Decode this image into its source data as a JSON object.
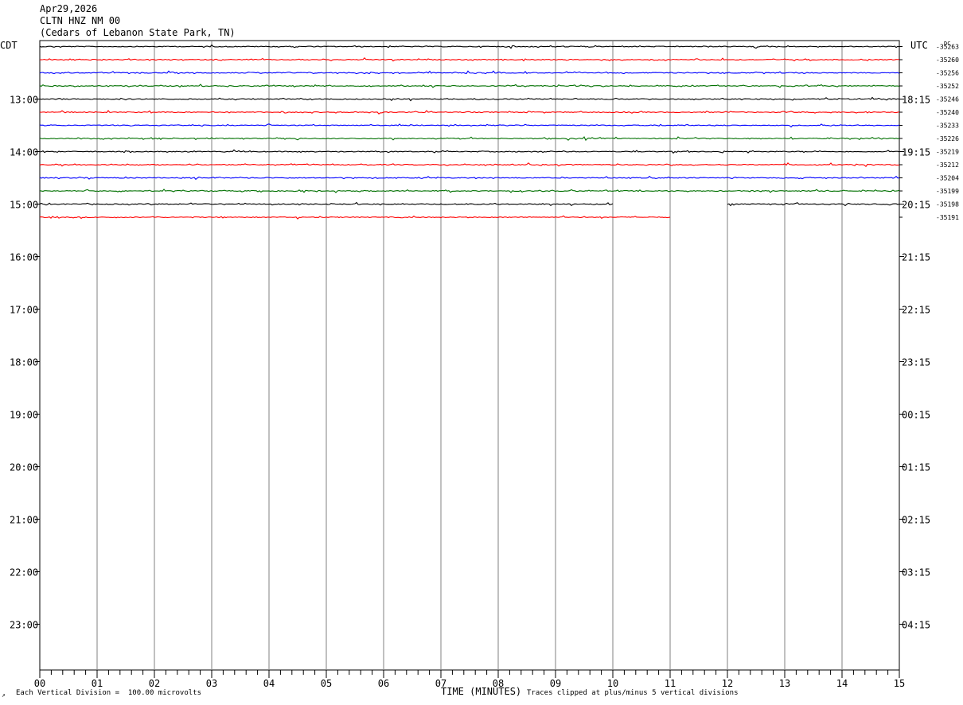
{
  "header": {
    "date": "Apr29,2026",
    "station": "CLTN HNZ NM 00",
    "location": "(Cedars of Lebanon State Park, TN)"
  },
  "labels": {
    "left_tz": "CDT",
    "right_tz": "UTC",
    "dc_label": "DC",
    "x_title": "TIME (MINUTES)",
    "scale_note": "Each Vertical Division =  100.00 microvolts",
    "clip_note": "Traces clipped at plus/minus 5 vertical divisions",
    "corner_mark": "↗"
  },
  "colors": {
    "trace_cycle": [
      "#000000",
      "#ff0000",
      "#0000ff",
      "#007000"
    ],
    "grid": "#808080"
  },
  "chart_data": {
    "type": "line",
    "x_range_minutes": [
      0,
      15
    ],
    "x_ticks": [
      "00",
      "01",
      "02",
      "03",
      "04",
      "05",
      "06",
      "07",
      "08",
      "09",
      "10",
      "11",
      "12",
      "13",
      "14",
      "15"
    ],
    "minor_tick_step_minutes": 0.2,
    "row_minutes": 15,
    "rows_per_hour": 4,
    "left_hour_labels": [
      "13:00",
      "14:00",
      "15:00",
      "16:00",
      "17:00",
      "18:00",
      "19:00",
      "20:00",
      "21:00",
      "22:00",
      "23:00"
    ],
    "right_hour_labels": [
      "18:15",
      "19:15",
      "20:15",
      "21:15",
      "22:15",
      "23:15",
      "00:15",
      "01:15",
      "02:15",
      "03:15",
      "04:15"
    ],
    "first_label_row": 4,
    "traces": [
      {
        "dc": "-35263",
        "segments": [
          [
            0,
            15
          ]
        ]
      },
      {
        "dc": "-35260",
        "segments": [
          [
            0,
            15
          ]
        ]
      },
      {
        "dc": "-35256",
        "segments": [
          [
            0,
            15
          ]
        ]
      },
      {
        "dc": "-35252",
        "segments": [
          [
            0,
            15
          ]
        ]
      },
      {
        "dc": "-35246",
        "segments": [
          [
            0,
            15
          ]
        ]
      },
      {
        "dc": "-35240",
        "segments": [
          [
            0,
            15
          ]
        ]
      },
      {
        "dc": "-35233",
        "segments": [
          [
            0,
            15
          ]
        ]
      },
      {
        "dc": "-35226",
        "segments": [
          [
            0,
            15
          ]
        ]
      },
      {
        "dc": "-35219",
        "segments": [
          [
            0,
            15
          ]
        ]
      },
      {
        "dc": "-35212",
        "segments": [
          [
            0,
            15
          ]
        ]
      },
      {
        "dc": "-35204",
        "segments": [
          [
            0,
            15
          ]
        ]
      },
      {
        "dc": "-35199",
        "segments": [
          [
            0,
            15
          ]
        ]
      },
      {
        "dc": "-35198",
        "segments": [
          [
            0,
            10
          ],
          [
            12,
            15
          ]
        ]
      },
      {
        "dc": "-35191",
        "segments": [
          [
            0,
            11
          ]
        ]
      }
    ]
  }
}
